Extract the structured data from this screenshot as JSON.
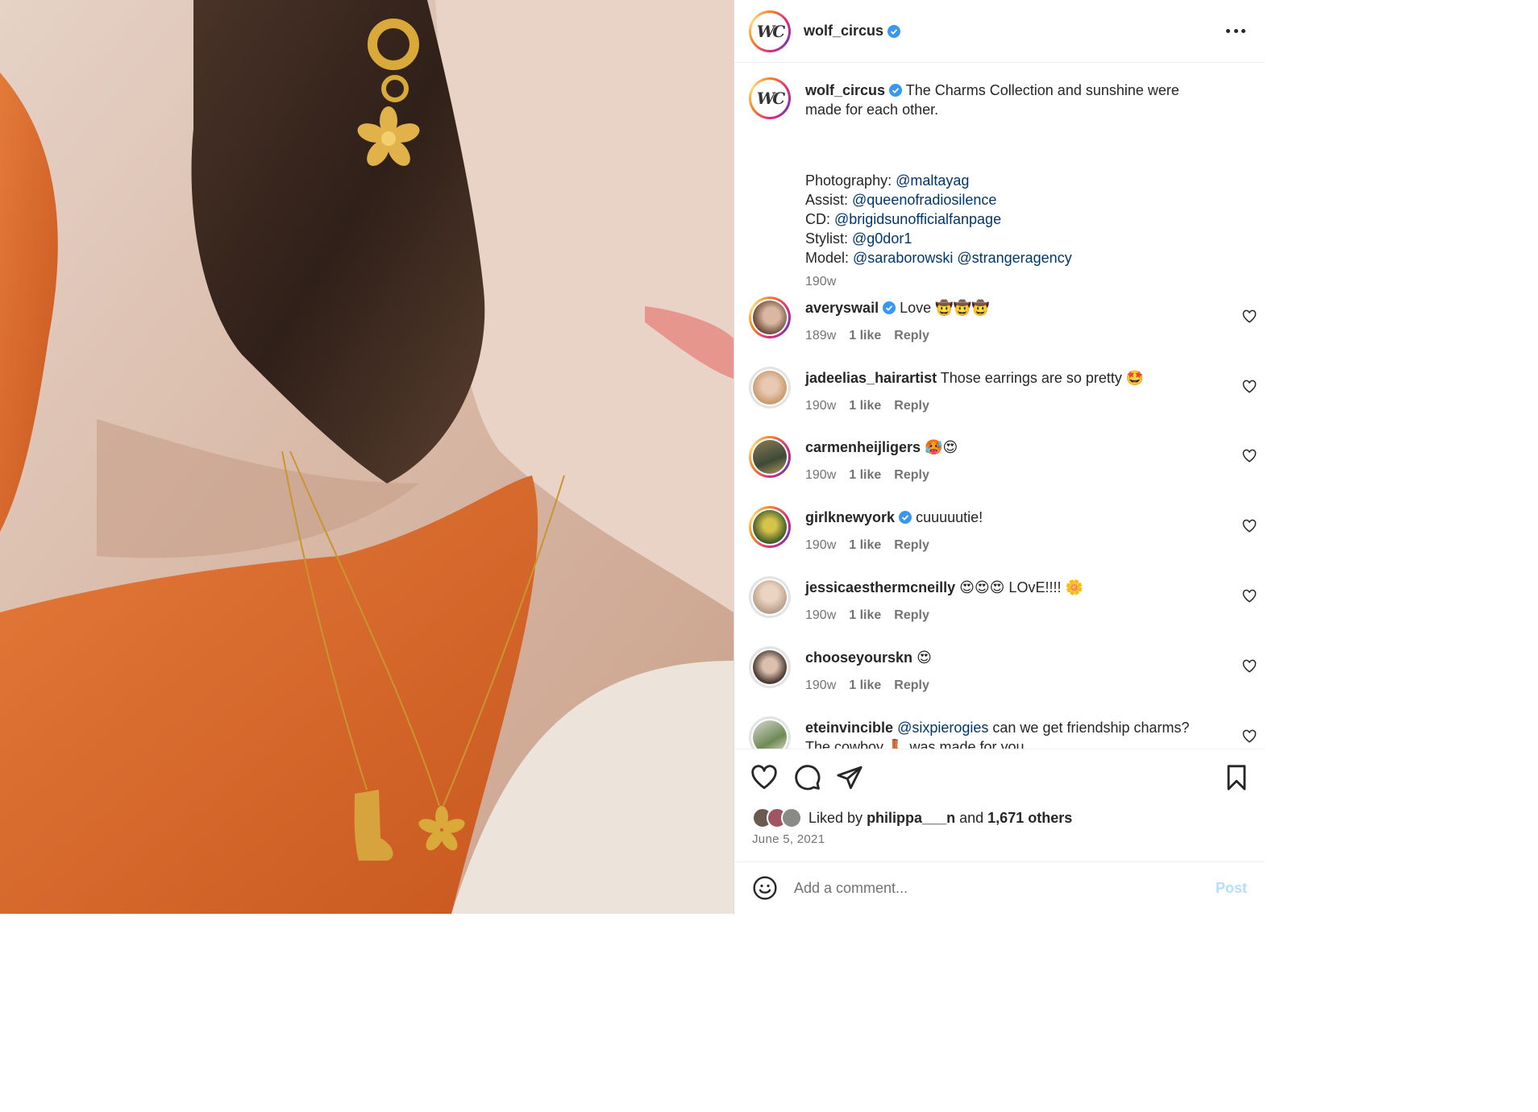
{
  "post": {
    "author": "wolf_circus",
    "author_initials": "WC",
    "more_icon": "more-horizontal-icon"
  },
  "caption": {
    "username": "wolf_circus",
    "line1": "The Charms Collection and sunshine were",
    "line2": "made for each other.",
    "credits": [
      {
        "label": "Photography: ",
        "mentions": "@maltayag"
      },
      {
        "label": "Assist: ",
        "mentions": "@queenofradiosilence"
      },
      {
        "label": "CD: ",
        "mentions": "@brigidsunofficialfanpage"
      },
      {
        "label": "Stylist: ",
        "mentions": "@g0dor1"
      },
      {
        "label": "Model: ",
        "mentions": "@saraborowski @strangeragency"
      }
    ],
    "time": "190w"
  },
  "comments": [
    {
      "username": "averyswail",
      "verified": true,
      "text": "Love 🤠🤠🤠",
      "time": "189w",
      "likes": "1 like",
      "reply": "Reply"
    },
    {
      "username": "jadeelias_hairartist",
      "verified": false,
      "text": "Those earrings are so pretty 🤩",
      "time": "190w",
      "likes": "1 like",
      "reply": "Reply"
    },
    {
      "username": "carmenheijligers",
      "verified": false,
      "text": "🥵😍",
      "time": "190w",
      "likes": "1 like",
      "reply": "Reply"
    },
    {
      "username": "girlknewyork",
      "verified": true,
      "text": "cuuuuutie!",
      "time": "190w",
      "likes": "1 like",
      "reply": "Reply"
    },
    {
      "username": "jessicaesthermcneilly",
      "verified": false,
      "text": "😍😍😍 LOvE!!!! 🌼",
      "time": "190w",
      "likes": "1 like",
      "reply": "Reply"
    },
    {
      "username": "chooseyourskn",
      "verified": false,
      "text": "😍",
      "time": "190w",
      "likes": "1 like",
      "reply": "Reply"
    },
    {
      "username": "eteinvincible",
      "verified": false,
      "mention": "@sixpierogies",
      "text": "can we get friendship charms?",
      "text2": "The cowboy 👢 was made for you"
    }
  ],
  "engagement": {
    "liked_by_prefix": "Liked by ",
    "liked_by_user": "philippa___n",
    "liked_by_mid": " and ",
    "others": "1,671 others",
    "date": "June 5, 2021"
  },
  "composer": {
    "placeholder": "Add a comment...",
    "post_label": "Post"
  },
  "colors": {
    "verified": "#3897f0",
    "mention": "#00376b",
    "post_disabled": "#b2dffc",
    "secondary_text": "#737373"
  }
}
